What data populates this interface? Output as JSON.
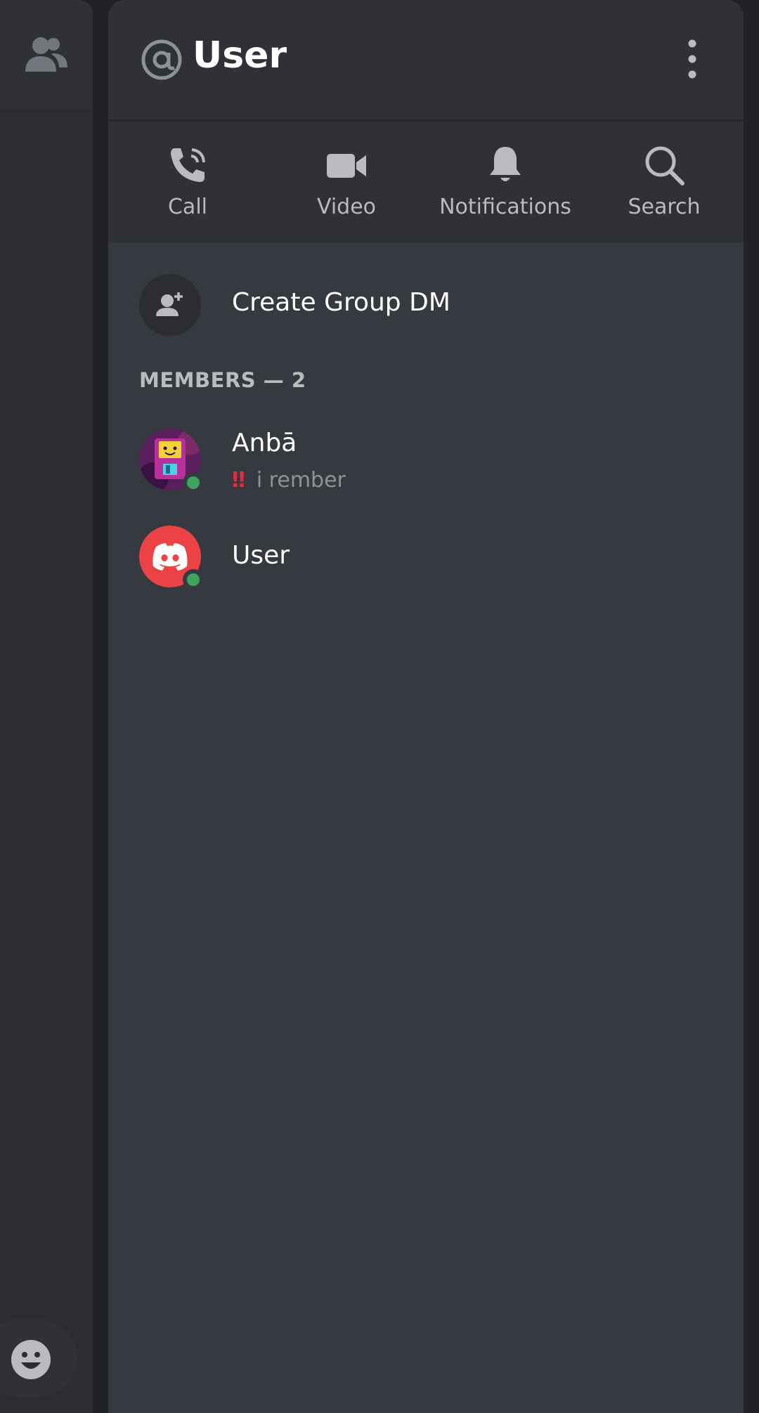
{
  "header": {
    "title": "User"
  },
  "actions": [
    {
      "label": "Call",
      "icon": "phone-icon"
    },
    {
      "label": "Video",
      "icon": "video-camera-icon"
    },
    {
      "label": "Notifications",
      "icon": "bell-icon"
    },
    {
      "label": "Search",
      "icon": "search-icon"
    }
  ],
  "create_group": {
    "label": "Create Group DM",
    "icon": "add-user-icon"
  },
  "members": {
    "header": "MEMBERS — 2",
    "list": [
      {
        "name": "Anbā",
        "status_emoji": "‼",
        "status_text": "i rember",
        "online": true
      },
      {
        "name": "User",
        "online": true
      }
    ]
  },
  "colors": {
    "background": "#36393f",
    "header_bg": "#2f3136",
    "online": "#3ba55d",
    "discord_red": "#ed4245",
    "text_primary": "#ffffff",
    "text_muted": "#b9bbbe"
  }
}
